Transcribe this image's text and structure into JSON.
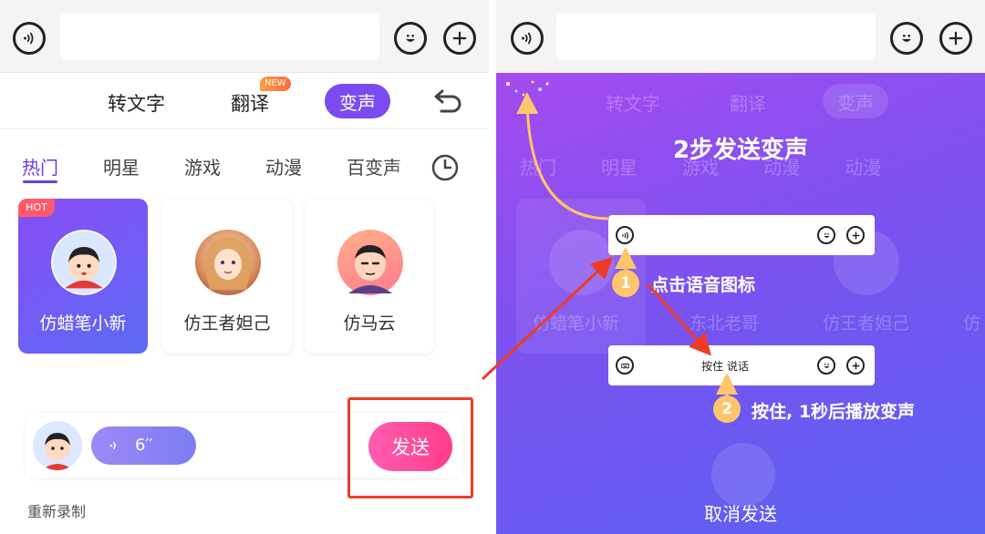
{
  "left_panel": {
    "modes": {
      "to_text": "转文字",
      "translate": "翻译",
      "new_tag": "NEW",
      "voice_change": "变声"
    },
    "categories": [
      "热门",
      "明星",
      "游戏",
      "动漫",
      "百变声"
    ],
    "cards": [
      {
        "tag": "HOT",
        "name": "仿蜡笔小新"
      },
      {
        "name": "仿王者妲己"
      },
      {
        "name": "仿马云"
      }
    ],
    "voice_message": {
      "duration": "6′′"
    },
    "send_label": "发送",
    "rerecord_label": "重新录制"
  },
  "right_panel": {
    "ghost_modes": {
      "to_text": "转文字",
      "translate": "翻译",
      "voice_change": "变声"
    },
    "ghost_categories": [
      "热门",
      "明星",
      "游戏",
      "动漫"
    ],
    "ghost_cards": [
      "仿蜡笔小新",
      "东北老哥",
      "仿王者妲己",
      "仿"
    ],
    "heading": "2步发送变声",
    "step1": {
      "number": "1",
      "text": "点击语音图标"
    },
    "hold_button": "按住 说话",
    "step2": {
      "number": "2",
      "text": "按住, 1秒后播放变声"
    },
    "cancel_label": "取消发送"
  },
  "colors": {
    "accent_purple": "#7a4cf0",
    "send_pink": "#ff3d8a",
    "highlight_red": "#ee3b28",
    "step_orange": "#ffc56b"
  }
}
